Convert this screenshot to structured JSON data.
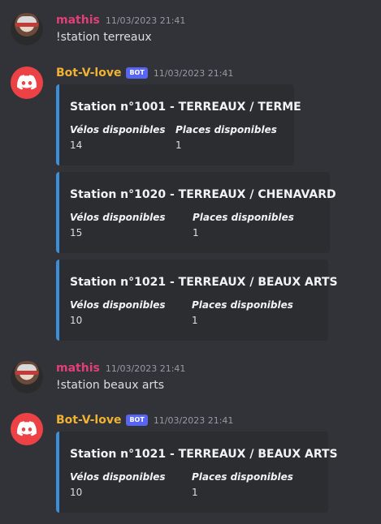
{
  "messages": [
    {
      "author": "mathis",
      "timestamp": "11/03/2023 21:41",
      "text": "!station terreaux"
    },
    {
      "author": "Bot-V-love",
      "bot_tag": "BOT",
      "timestamp": "11/03/2023 21:41",
      "embeds": [
        {
          "title": "Station n°1001 - TERREAUX / TERME",
          "fields": [
            {
              "name": "Vélos disponibles",
              "value": "14"
            },
            {
              "name": "Places disponibles",
              "value": "1"
            }
          ]
        },
        {
          "title": "Station n°1020 - TERREAUX / CHENAVARD",
          "fields": [
            {
              "name": "Vélos disponibles",
              "value": "15"
            },
            {
              "name": "Places disponibles",
              "value": "1"
            }
          ]
        },
        {
          "title": "Station n°1021 - TERREAUX / BEAUX ARTS",
          "fields": [
            {
              "name": "Vélos disponibles",
              "value": "10"
            },
            {
              "name": "Places disponibles",
              "value": "1"
            }
          ]
        }
      ]
    },
    {
      "author": "mathis",
      "timestamp": "11/03/2023 21:41",
      "text": "!station beaux arts"
    },
    {
      "author": "Bot-V-love",
      "bot_tag": "BOT",
      "timestamp": "11/03/2023 21:41",
      "embeds": [
        {
          "title": "Station n°1021 - TERREAUX / BEAUX ARTS",
          "fields": [
            {
              "name": "Vélos disponibles",
              "value": "10"
            },
            {
              "name": "Places disponibles",
              "value": "1"
            }
          ]
        }
      ]
    }
  ],
  "colors": {
    "background": "#313338",
    "embed_background": "#2b2d31",
    "embed_accent": "#3b8fd6",
    "user_name": "#e23f77",
    "bot_name": "#f0b232",
    "bot_tag": "#5865f2",
    "bot_avatar": "#ed4245"
  },
  "icons": {
    "bot_avatar": "discord-logo-icon",
    "user_avatar": "user-avatar"
  }
}
